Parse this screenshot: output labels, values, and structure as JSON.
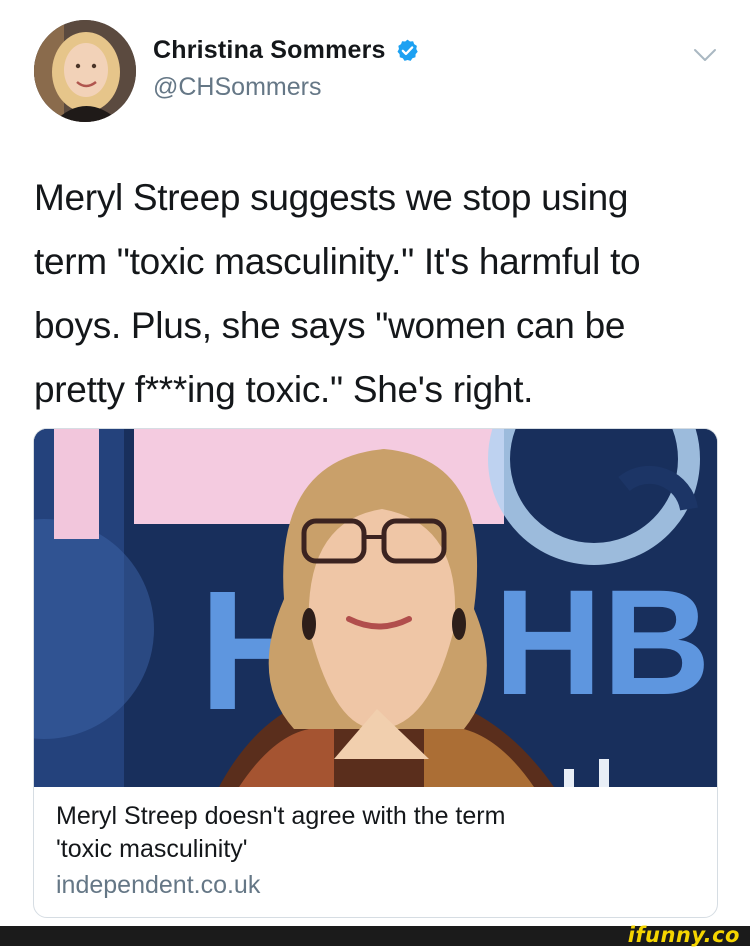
{
  "tweet": {
    "author": {
      "display_name": "Christina Sommers",
      "handle": "@CHSommers",
      "verified_icon": "verified-badge-icon",
      "verified_color": "#1da1f2"
    },
    "menu_icon": "chevron-down-icon",
    "text_lines": [
      "Meryl Streep suggests we stop using",
      "term \"toxic masculinity.\" It's harmful to",
      "boys. Plus, she says \"women can be",
      "pretty f***ing toxic.\" She's right."
    ]
  },
  "link_card": {
    "title_lines": [
      "Meryl Streep doesn't agree with the term",
      "'toxic masculinity'"
    ],
    "domain": "independent.co.uk",
    "backdrop_letters": [
      "HB",
      "H"
    ]
  },
  "watermark": {
    "text": "ifunny.co",
    "color": "#f5d500"
  }
}
